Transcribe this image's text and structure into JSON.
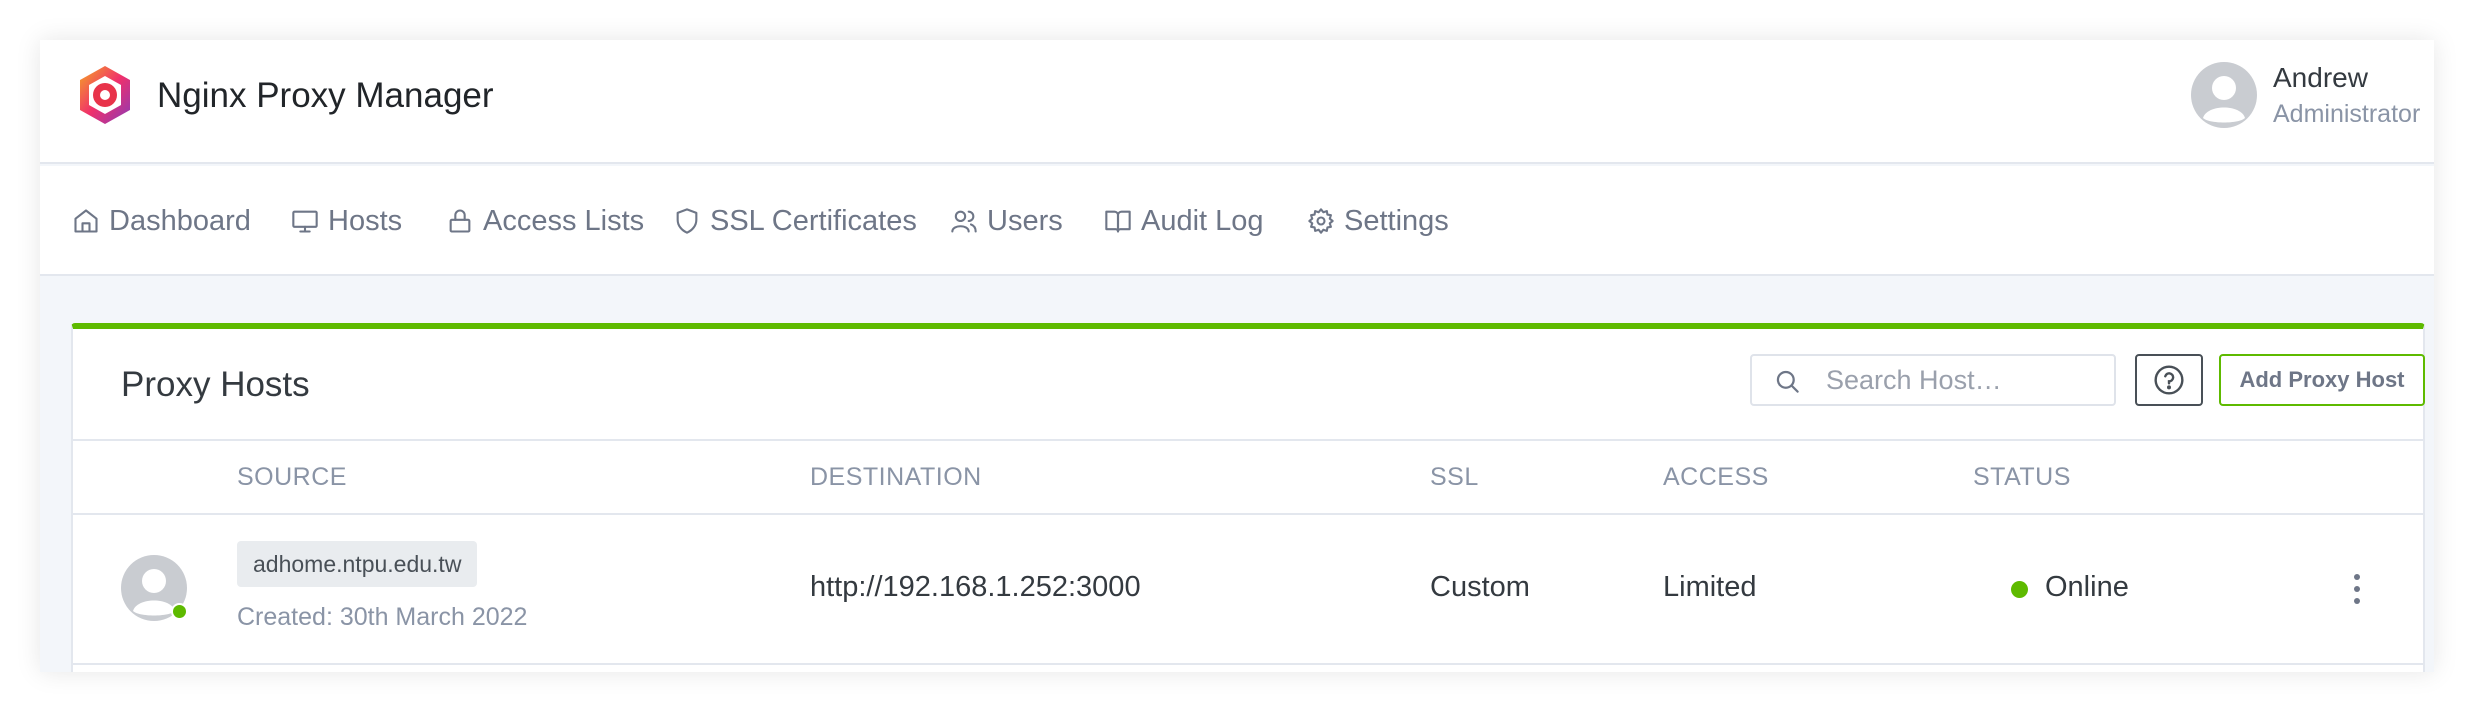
{
  "app": {
    "title": "Nginx Proxy Manager"
  },
  "user": {
    "name": "Andrew",
    "role": "Administrator"
  },
  "nav": {
    "items": [
      {
        "label": "Dashboard",
        "icon": "home-icon"
      },
      {
        "label": "Hosts",
        "icon": "monitor-icon"
      },
      {
        "label": "Access Lists",
        "icon": "lock-icon"
      },
      {
        "label": "SSL Certificates",
        "icon": "shield-icon"
      },
      {
        "label": "Users",
        "icon": "users-icon"
      },
      {
        "label": "Audit Log",
        "icon": "book-open-icon"
      },
      {
        "label": "Settings",
        "icon": "gear-icon"
      }
    ]
  },
  "card": {
    "title": "Proxy Hosts",
    "accent_color": "#5eba00",
    "search_placeholder": "Search Host…",
    "add_button": "Add Proxy Host"
  },
  "table": {
    "columns": [
      "SOURCE",
      "DESTINATION",
      "SSL",
      "ACCESS",
      "STATUS"
    ],
    "rows": [
      {
        "domain": "adhome.ntpu.edu.tw",
        "created": "Created: 30th March 2022",
        "destination": "http://192.168.1.252:3000",
        "ssl": "Custom",
        "access": "Limited",
        "status": "Online",
        "status_color": "#5eba00"
      }
    ]
  }
}
